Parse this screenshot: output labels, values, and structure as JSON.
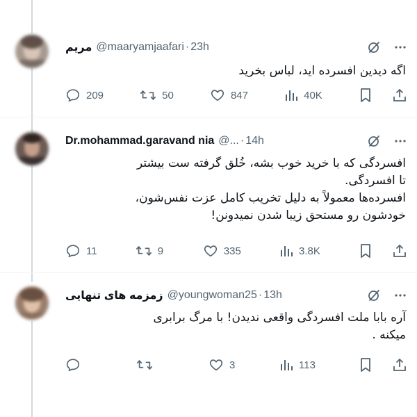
{
  "tweets": [
    {
      "name": "مریم",
      "handle": "@maaryamjaafari",
      "time": "23h",
      "body": [
        "اگه دیدین افسرده اید، لباس بخرید"
      ],
      "replies": "209",
      "retweets": "50",
      "likes": "847",
      "views": "40K"
    },
    {
      "name": "Dr.mohammad.garavand nia",
      "handle": "@...",
      "time": "14h",
      "body": [
        "افسردگی که با خرید خوب بشه، خُلق گرفته ست بیشتر",
        "تا افسردگی.",
        "افسرده‌ها معمولاً به دلیل تخریب کامل عزت نفس‌شون،",
        "خودشون رو مستحق زیبا شدن نمیدونن!"
      ],
      "replies": "11",
      "retweets": "9",
      "likes": "335",
      "views": "3.8K"
    },
    {
      "name": "زمزمه های تنهایی",
      "handle": "@youngwoman25",
      "time": "13h",
      "body": [
        "آره بابا ملت افسردگی واقعی ندیدن! با مرگ برابری",
        "میکنه ."
      ],
      "replies": "",
      "retweets": "",
      "likes": "3",
      "views": "113"
    }
  ],
  "icons": {
    "grok": "grok-icon",
    "more": "more-icon",
    "reply": "reply-icon",
    "retweet": "retweet-icon",
    "like": "like-icon",
    "views": "views-icon",
    "bookmark": "bookmark-icon",
    "share": "share-icon"
  },
  "colors": {
    "text": "#0f1419",
    "secondary": "#536471",
    "thread_line": "#cfd9de"
  }
}
